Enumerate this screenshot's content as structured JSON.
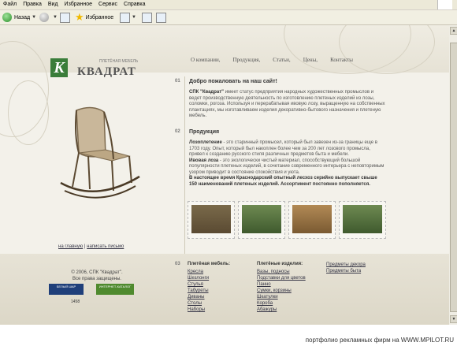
{
  "browser": {
    "menu": [
      "Файл",
      "Правка",
      "Вид",
      "Избранное",
      "Сервис",
      "Справка"
    ],
    "back_label": "Назад",
    "favorites_label": "Избранное"
  },
  "site": {
    "logo_name": "КВАДРАТ",
    "logo_tagline": "ПЛЕТЁНАЯ МЕБЕЛЬ",
    "nav": [
      "О компании,",
      "Продукция,",
      "Статьи,",
      "Цены,",
      "Контакты"
    ],
    "left_links": [
      "на главную",
      "написать письмо"
    ],
    "sections": [
      {
        "num": "01",
        "title": "Добро пожаловать на наш сайт!",
        "text_bold": "СПК \"Квадрат\"",
        "text": " имеет статус предприятия народных художественных промыслов и ведет производственную деятельность по изготовлению плетеных изделий из лозы, соломки, рогоза. Используя и перерабатывая ивовую лозу, выращенную на собственных плантациях, мы изготавливаем изделия декоративно-бытового назначения и плетеную мебель."
      },
      {
        "num": "02",
        "title": "Продукция",
        "p1_bold": "Лозоплетение",
        "p1": " - это старинный промысел, который был завезен из-за границы еще в 1703 году. Опыт, который был накоплен более чем за 200 лет лозового промысла, привел к созданию русского стиля различных предметов быта и мебели.",
        "p2_bold": "Ивовая лоза",
        "p2": " - это экологически чистый материал, способствующий большой популярности плетеных изделий, в сочетание современного интерьера с неповторимым узором приводит в состояние спокойствия и уюта.",
        "p3": "В настоящее время Краснодарский опытный лесхоз серийно выпускает свыше 150 наименований плетеных изделий. Ассортимент постоянно пополняется."
      }
    ],
    "footer": {
      "copyright": "© 2006, СПК \"Квадрат\".",
      "rights": "Все права защищены.",
      "num": "03",
      "col1_title": "Плетёная мебель:",
      "col1": [
        "Кресла",
        "Шезлонги",
        "Стулья",
        "Табуреты",
        "Диваны",
        "Столы",
        "Наборы"
      ],
      "col2_title": "Плетёные изделия:",
      "col2": [
        "Вазы, подносы",
        "Подставки для цветов",
        "Панно",
        "Сумки, корзины",
        "Шкатулки",
        "Короба",
        "Абажуры"
      ],
      "col3": [
        "Предметы декора",
        "Предметы быта"
      ],
      "badge1": "БЕЛЫЙ ШАР",
      "badge2": "ИНТЕРНЕТ-КАТАЛОГ",
      "counter": "1458"
    }
  },
  "watermark": "портфолио рекламных фирм на WWW.MPILOT.RU"
}
